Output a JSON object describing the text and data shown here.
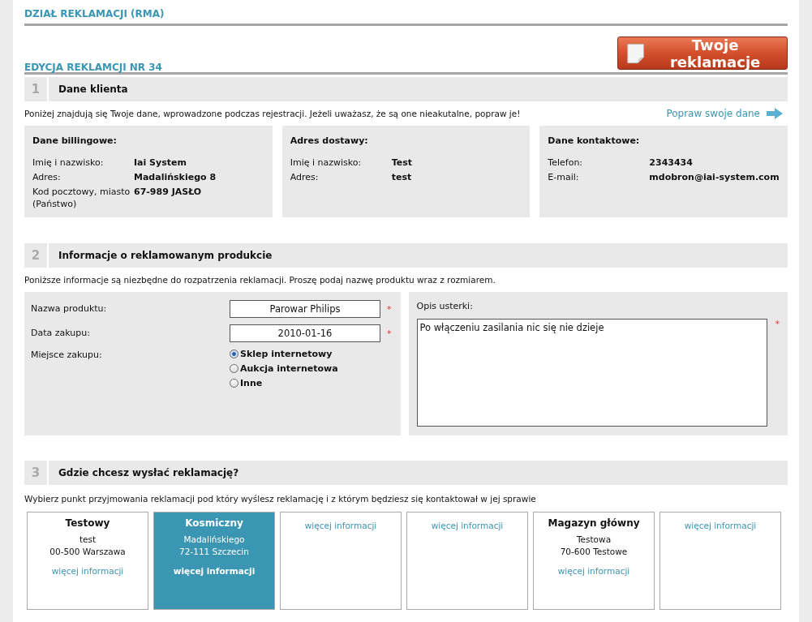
{
  "header": {
    "title": "DZIAŁ REKLAMACJI (RMA)"
  },
  "complaints_button": {
    "label": "Twoje reklamacje"
  },
  "edit_title": "EDYCJA REKLAMCJI NR 34",
  "customer": {
    "number": "1",
    "heading": "Dane klienta",
    "intro": "Poniżej znajdują się Twoje dane, wprowadzone podczas rejestracji. Jeżeli uważasz, że są one nieakutalne, popraw je!",
    "edit_link": "Popraw swoje dane",
    "panels": [
      {
        "title": "Dane billingowe:",
        "rows": [
          {
            "label": "Imię i nazwisko:",
            "value": "Iai System"
          },
          {
            "label": "Adres:",
            "value": "Madalińskiego 8"
          },
          {
            "label": "Kod pocztowy, miasto (Państwo)",
            "value": "67-989 JASŁO"
          }
        ]
      },
      {
        "title": "Adres dostawy:",
        "rows": [
          {
            "label": "Imię i nazwisko:",
            "value": "Test"
          },
          {
            "label": "Adres:",
            "value": "test"
          }
        ]
      },
      {
        "title": "Dane kontaktowe:",
        "rows": [
          {
            "label": "Telefon:",
            "value": "2343434"
          },
          {
            "label": "E-mail:",
            "value": "mdobron@iai-system.com"
          }
        ]
      }
    ]
  },
  "product": {
    "number": "2",
    "heading": "Informacje o reklamowanym produkcie",
    "intro": "Poniższe informacje są niezbędne do rozpatrzenia reklamacji. Proszę podaj nazwę produktu wraz z rozmiarem.",
    "fields": [
      {
        "label": "Nazwa produktu:",
        "value": "Parowar Philips",
        "required_mark": "*"
      },
      {
        "label": "Data zakupu:",
        "value": "2010-01-16",
        "required_mark": "*"
      }
    ],
    "purchase_place": {
      "label": "Miejsce zakupu:",
      "options": [
        {
          "label": "Sklep internetowy",
          "selected": true
        },
        {
          "label": "Aukcja internetowa",
          "selected": false
        },
        {
          "label": "Inne",
          "selected": false
        }
      ]
    },
    "description": {
      "label": "Opis usterki:",
      "value": "Po włączeniu zasilania nic się nie dzieje",
      "required_mark": "*"
    }
  },
  "service_point": {
    "number": "3",
    "heading": "Gdzie chcesz wysłać reklamację?",
    "intro": "Wybierz punkt przyjmowania reklamacji pod który wyślesz reklamację i z którym będziesz się kontaktował w jej sprawie",
    "points": [
      {
        "name": "Testowy",
        "lines": [
          "test",
          "00-500 Warszawa"
        ],
        "link": "więcej informacji",
        "selected": false
      },
      {
        "name": "Kosmiczny",
        "lines": [
          "Madalińskiego",
          "72-111 Szczecin"
        ],
        "link": "więcej informacji",
        "selected": true
      },
      {
        "link": "więcej informacji",
        "selected": false
      },
      {
        "link": "więcej informacji",
        "selected": false
      },
      {
        "name": "Magazyn główny",
        "lines": [
          "Testowa",
          "70-600 Testowe"
        ],
        "link": "więcej informacji",
        "selected": false
      },
      {
        "link": "więcej informacji",
        "selected": false
      }
    ]
  }
}
